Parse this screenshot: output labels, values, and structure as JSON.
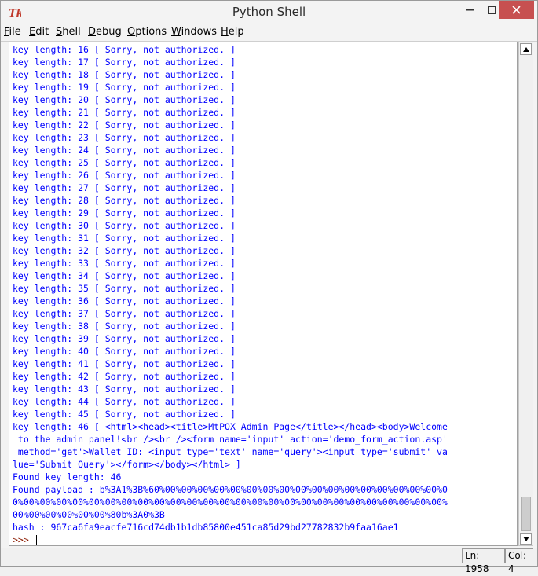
{
  "window": {
    "title": "Python Shell",
    "app_icon": "tk-feather-icon"
  },
  "menu": [
    {
      "label": "File",
      "accel": "F",
      "rest": "ile"
    },
    {
      "label": "Edit",
      "accel": "E",
      "rest": "dit"
    },
    {
      "label": "Shell",
      "accel": "S",
      "rest": "hell"
    },
    {
      "label": "Debug",
      "accel": "D",
      "rest": "ebug"
    },
    {
      "label": "Options",
      "accel": "O",
      "rest": "ptions"
    },
    {
      "label": "Windows",
      "accel": "W",
      "rest": "indows"
    },
    {
      "label": "Help",
      "accel": "H",
      "rest": "elp"
    }
  ],
  "output_lines": [
    "key length: 16 [ Sorry, not authorized. ]",
    "key length: 17 [ Sorry, not authorized. ]",
    "key length: 18 [ Sorry, not authorized. ]",
    "key length: 19 [ Sorry, not authorized. ]",
    "key length: 20 [ Sorry, not authorized. ]",
    "key length: 21 [ Sorry, not authorized. ]",
    "key length: 22 [ Sorry, not authorized. ]",
    "key length: 23 [ Sorry, not authorized. ]",
    "key length: 24 [ Sorry, not authorized. ]",
    "key length: 25 [ Sorry, not authorized. ]",
    "key length: 26 [ Sorry, not authorized. ]",
    "key length: 27 [ Sorry, not authorized. ]",
    "key length: 28 [ Sorry, not authorized. ]",
    "key length: 29 [ Sorry, not authorized. ]",
    "key length: 30 [ Sorry, not authorized. ]",
    "key length: 31 [ Sorry, not authorized. ]",
    "key length: 32 [ Sorry, not authorized. ]",
    "key length: 33 [ Sorry, not authorized. ]",
    "key length: 34 [ Sorry, not authorized. ]",
    "key length: 35 [ Sorry, not authorized. ]",
    "key length: 36 [ Sorry, not authorized. ]",
    "key length: 37 [ Sorry, not authorized. ]",
    "key length: 38 [ Sorry, not authorized. ]",
    "key length: 39 [ Sorry, not authorized. ]",
    "key length: 40 [ Sorry, not authorized. ]",
    "key length: 41 [ Sorry, not authorized. ]",
    "key length: 42 [ Sorry, not authorized. ]",
    "key length: 43 [ Sorry, not authorized. ]",
    "key length: 44 [ Sorry, not authorized. ]",
    "key length: 45 [ Sorry, not authorized. ]",
    "key length: 46 [ <html><head><title>MtPOX Admin Page</title></head><body>Welcome",
    " to the admin panel!<br /><br /><form name='input' action='demo_form_action.asp'",
    " method='get'>Wallet ID: <input type='text' name='query'><input type='submit' va",
    "lue='Submit Query'></form></body></html> ]",
    "Found key length: 46",
    "Found payload : b%3A1%3B%60%00%00%00%00%00%00%00%00%00%00%00%00%00%00%00%00%00%0",
    "0%00%00%00%00%00%00%00%00%00%00%00%00%00%00%00%00%00%00%00%00%00%00%00%00%00%00%",
    "00%00%00%00%00%00%80b%3A0%3B",
    "hash : 967ca6fa9eacfe716cd74db1b1db85800e451ca85d29bd27782832b9faa16ae1"
  ],
  "prompt": ">>>",
  "status": {
    "line": "Ln: 1958",
    "col": "Col: 4"
  },
  "colors": {
    "output": "#0000ff",
    "prompt": "#8b1a00",
    "close_button": "#c75050"
  }
}
